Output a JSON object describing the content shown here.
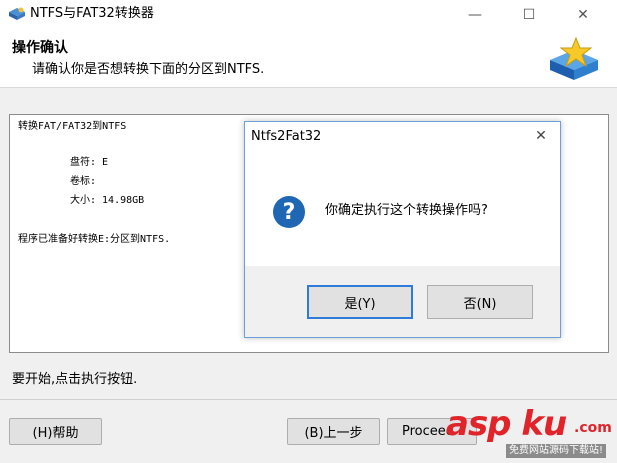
{
  "window": {
    "title": "NTFS与FAT32转换器",
    "controls": {
      "minimize": "—",
      "maximize": "☐",
      "close": "✕"
    }
  },
  "header": {
    "title": "操作确认",
    "subtitle": "请确认你是否想转换下面的分区到NTFS.",
    "logo_icon": "star-box-icon"
  },
  "log": {
    "line1": "转换FAT/FAT32到NTFS",
    "line2": "盘符: E",
    "line3": "卷标:",
    "line4": "大小: 14.98GB",
    "line5": "程序已准备好转换E:分区到NTFS."
  },
  "status": {
    "text": "要开始,点击执行按钮."
  },
  "buttons": {
    "help": "(H)帮助",
    "back": "(B)上一步",
    "proceed": "Proceed"
  },
  "dialog": {
    "title": "Ntfs2Fat32",
    "close": "✕",
    "icon": "question-icon",
    "message": "你确定执行这个转换操作吗?",
    "yes": "是(Y)",
    "no": "否(N)"
  },
  "watermark": {
    "main": "asp ku",
    "com": ".com",
    "sub": "免费网站源码下载站!"
  },
  "colors": {
    "accent": "#2f7bd8",
    "question_icon": "#1f67b3",
    "watermark": "#e1242a"
  }
}
